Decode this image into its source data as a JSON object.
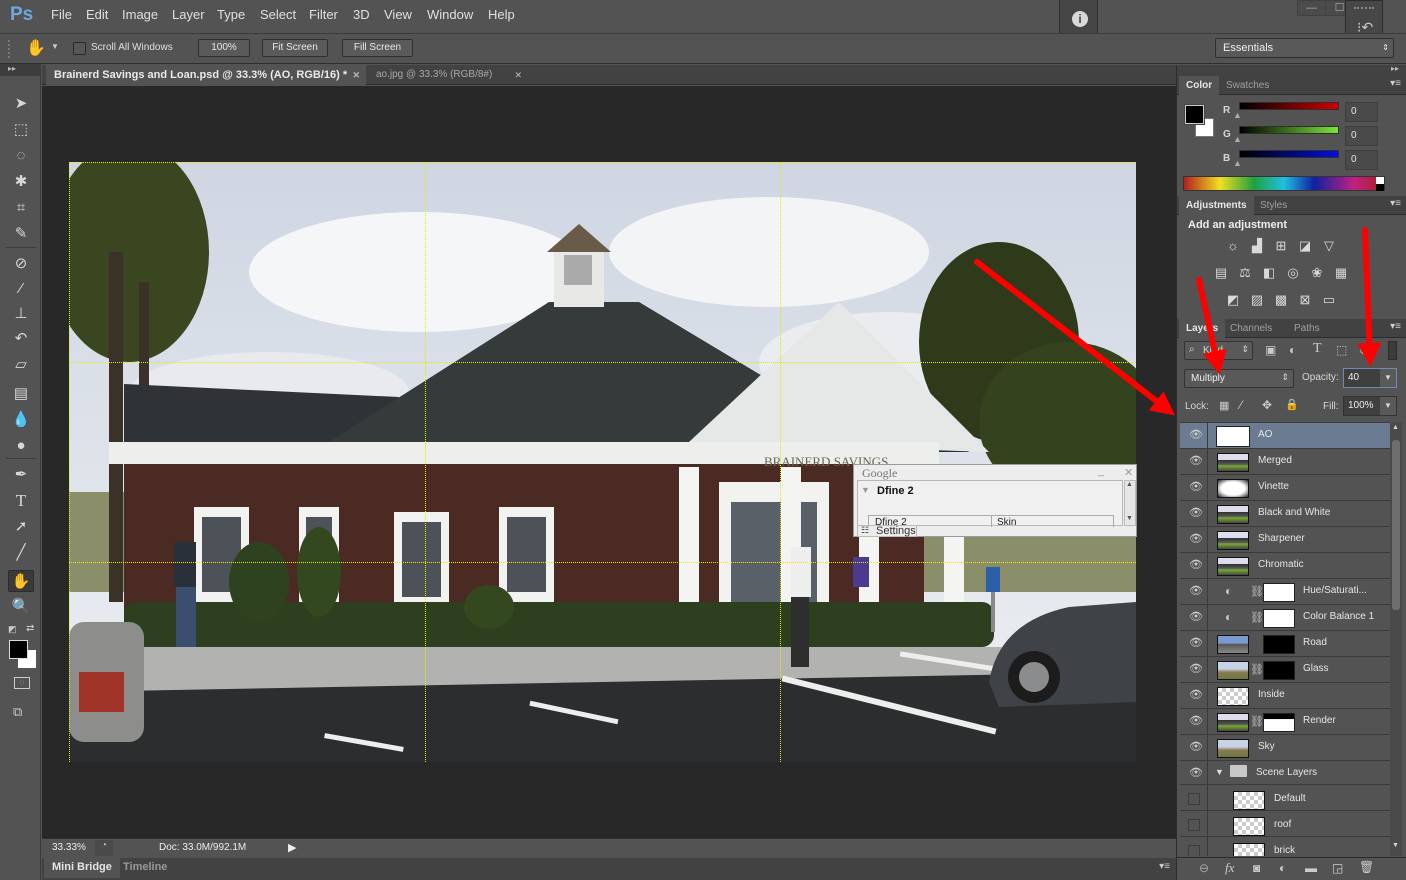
{
  "app": {
    "logo": "Ps"
  },
  "menu": [
    "File",
    "Edit",
    "Image",
    "Layer",
    "Type",
    "Select",
    "Filter",
    "3D",
    "View",
    "Window",
    "Help"
  ],
  "window_controls": {
    "minimize": "—",
    "maximize": "☐",
    "close": "✕"
  },
  "options_bar": {
    "tool_icon": "hand-icon",
    "scroll_all_windows": {
      "label": "Scroll All Windows",
      "checked": false
    },
    "buttons": [
      "100%",
      "Fit Screen",
      "Fill Screen"
    ],
    "workspace": "Essentials"
  },
  "document_tabs": [
    {
      "label": "Brainerd Savings and Loan.psd @ 33.3% (AO, RGB/16) *",
      "active": true
    },
    {
      "label": "ao.jpg @ 33.3% (RGB/8#)",
      "active": false
    }
  ],
  "tools": [
    "move-icon",
    "marquee-icon",
    "lasso-icon",
    "magic-wand-icon",
    "crop-icon",
    "eyedropper-icon",
    "healing-brush-icon",
    "brush-icon",
    "clone-stamp-icon",
    "history-brush-icon",
    "eraser-icon",
    "gradient-icon",
    "blur-icon",
    "dodge-icon",
    "pen-icon",
    "type-icon",
    "path-selection-icon",
    "line-icon",
    "hand-icon",
    "zoom-icon"
  ],
  "canvas": {
    "sign_text": "BRAINERD SAVINGS"
  },
  "google_panel": {
    "title": "Google",
    "section": "Dfine 2",
    "col1": "Dfine 2",
    "col2": "Skin",
    "settings": "Settings"
  },
  "status": {
    "zoom": "33.33%",
    "doc": "Doc: 33.0M/992.1M"
  },
  "bottom_tabs": [
    "Mini Bridge",
    "Timeline"
  ],
  "color_panel": {
    "tabs": [
      "Color",
      "Swatches"
    ],
    "channels": [
      {
        "label": "R",
        "value": "0",
        "color": "#d40000"
      },
      {
        "label": "G",
        "value": "0",
        "color": "#7ce63a"
      },
      {
        "label": "B",
        "value": "0",
        "color": "#0010e0"
      }
    ],
    "foreground": "#000000",
    "background": "#ffffff"
  },
  "adjustments_panel": {
    "tabs": [
      "Adjustments",
      "Styles"
    ],
    "heading": "Add an adjustment",
    "rows": [
      [
        "brightness-contrast-icon",
        "levels-icon",
        "curves-icon",
        "exposure-icon",
        "vibrance-icon"
      ],
      [
        "hue-saturation-icon",
        "color-balance-icon",
        "black-white-icon",
        "photo-filter-icon",
        "channel-mixer-icon",
        "color-lookup-icon"
      ],
      [
        "invert-icon",
        "posterize-icon",
        "threshold-icon",
        "selective-color-icon",
        "gradient-map-icon"
      ]
    ]
  },
  "layers_panel": {
    "tabs": [
      "Layers",
      "Channels",
      "Paths"
    ],
    "filter_kind": "Kind",
    "blend_mode": "Multiply",
    "opacity_label": "Opacity:",
    "opacity": "40",
    "lock_label": "Lock:",
    "fill_label": "Fill:",
    "fill": "100%",
    "layers": [
      {
        "name": "AO",
        "visible": true,
        "selected": true,
        "thumb": "ao"
      },
      {
        "name": "Merged",
        "visible": true,
        "thumb": "house"
      },
      {
        "name": "Vinette",
        "visible": true,
        "thumb": "vignette"
      },
      {
        "name": "Black and White",
        "visible": true,
        "thumb": "house"
      },
      {
        "name": "Sharpener",
        "visible": true,
        "thumb": "house"
      },
      {
        "name": "Chromatic",
        "visible": true,
        "thumb": "house"
      },
      {
        "name": "Hue/Saturati...",
        "visible": true,
        "thumb": "adjustment",
        "mask": "white"
      },
      {
        "name": "Color Balance 1",
        "visible": true,
        "thumb": "adjustment",
        "mask": "white"
      },
      {
        "name": "Road",
        "visible": true,
        "thumb": "road",
        "mask": "black"
      },
      {
        "name": "Glass",
        "visible": true,
        "thumb": "sky",
        "mask": "black"
      },
      {
        "name": "Inside",
        "visible": true,
        "thumb": "empty"
      },
      {
        "name": "Render",
        "visible": true,
        "thumb": "house",
        "mask": "render"
      },
      {
        "name": "Sky",
        "visible": true,
        "thumb": "sky"
      },
      {
        "name": "Scene Layers",
        "visible": true,
        "group": true
      },
      {
        "name": "Default",
        "visible": false,
        "thumb": "empty",
        "indent": true
      },
      {
        "name": "roof",
        "visible": false,
        "thumb": "empty",
        "indent": true
      },
      {
        "name": "brick",
        "visible": false,
        "thumb": "empty",
        "indent": true
      }
    ],
    "footer_icons": [
      "link-icon",
      "fx-icon",
      "add-mask-icon",
      "new-adjustment-icon",
      "new-group-icon",
      "new-layer-icon",
      "delete-icon"
    ]
  },
  "annotations": {
    "arrow_color": "#ff0000"
  }
}
